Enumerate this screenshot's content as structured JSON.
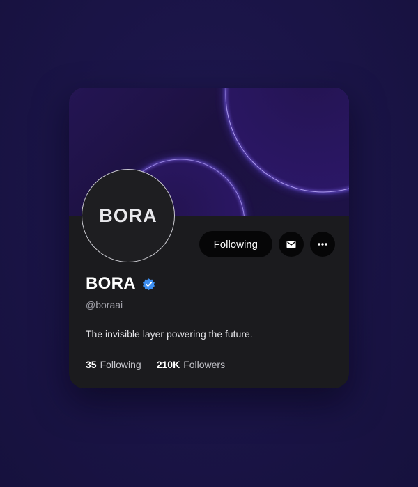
{
  "profile": {
    "logo_text": "BORA",
    "name": "BORA",
    "handle": "@boraai",
    "bio": "The invisible layer powering the future."
  },
  "actions": {
    "following_label": "Following",
    "message_icon": "envelope-icon",
    "more_icon": "more-horizontal-icon"
  },
  "stats": {
    "following_count": "35",
    "following_label": "Following",
    "followers_count": "210K",
    "followers_label": "Followers"
  },
  "colors": {
    "page_background": "#1a1446",
    "card_background": "#1b1b1e",
    "banner_glow": "#7a5cff",
    "verified_badge": "#3d8ef0",
    "button_background": "#060607"
  }
}
